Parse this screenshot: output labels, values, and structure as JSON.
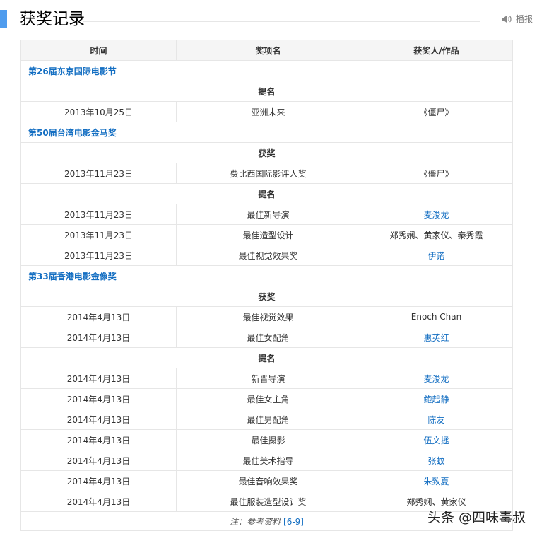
{
  "heading": {
    "title": "获奖记录",
    "report_label": "播报",
    "report_icon": "speaker-icon"
  },
  "table": {
    "headers": [
      "时间",
      "奖项名",
      "获奖人/作品"
    ],
    "festivals": [
      {
        "name": "第26届东京国际电影节",
        "sections": [
          {
            "label": "提名",
            "rows": [
              {
                "date": "2013年10月25日",
                "award": "亚洲未来",
                "winner": "《僵尸》",
                "link": false
              }
            ]
          }
        ]
      },
      {
        "name": "第50届台湾电影金马奖",
        "sections": [
          {
            "label": "获奖",
            "rows": [
              {
                "date": "2013年11月23日",
                "award": "费比西国际影评人奖",
                "winner": "《僵尸》",
                "link": false
              }
            ]
          },
          {
            "label": "提名",
            "rows": [
              {
                "date": "2013年11月23日",
                "award": "最佳新导演",
                "winner": "麦浚龙",
                "link": true
              },
              {
                "date": "2013年11月23日",
                "award": "最佳造型设计",
                "winner": "郑秀娴、黄家仪、秦秀霞",
                "link": false
              },
              {
                "date": "2013年11月23日",
                "award": "最佳视觉效果奖",
                "winner": "伊诺",
                "link": true
              }
            ]
          }
        ]
      },
      {
        "name": "第33届香港电影金像奖",
        "sections": [
          {
            "label": "获奖",
            "rows": [
              {
                "date": "2014年4月13日",
                "award": "最佳视觉效果",
                "winner": "Enoch Chan",
                "link": false
              },
              {
                "date": "2014年4月13日",
                "award": "最佳女配角",
                "winner": "惠英红",
                "link": true
              }
            ]
          },
          {
            "label": "提名",
            "rows": [
              {
                "date": "2014年4月13日",
                "award": "新晋导演",
                "winner": "麦浚龙",
                "link": true
              },
              {
                "date": "2014年4月13日",
                "award": "最佳女主角",
                "winner": "鲍起静",
                "link": true
              },
              {
                "date": "2014年4月13日",
                "award": "最佳男配角",
                "winner": "陈友",
                "link": true
              },
              {
                "date": "2014年4月13日",
                "award": "最佳摄影",
                "winner": "伍文拯",
                "link": true
              },
              {
                "date": "2014年4月13日",
                "award": "最佳美术指导",
                "winner": "张蚊",
                "link": true
              },
              {
                "date": "2014年4月13日",
                "award": "最佳音响效果奖",
                "winner": "朱致夏",
                "link": true
              },
              {
                "date": "2014年4月13日",
                "award": "最佳服装造型设计奖",
                "winner": "郑秀娴、黄家仪",
                "link": false
              }
            ]
          }
        ]
      }
    ],
    "note": {
      "text": "注：参考资料",
      "ref": "[6-9]"
    }
  },
  "watermark": "头条 @四味毒叔"
}
